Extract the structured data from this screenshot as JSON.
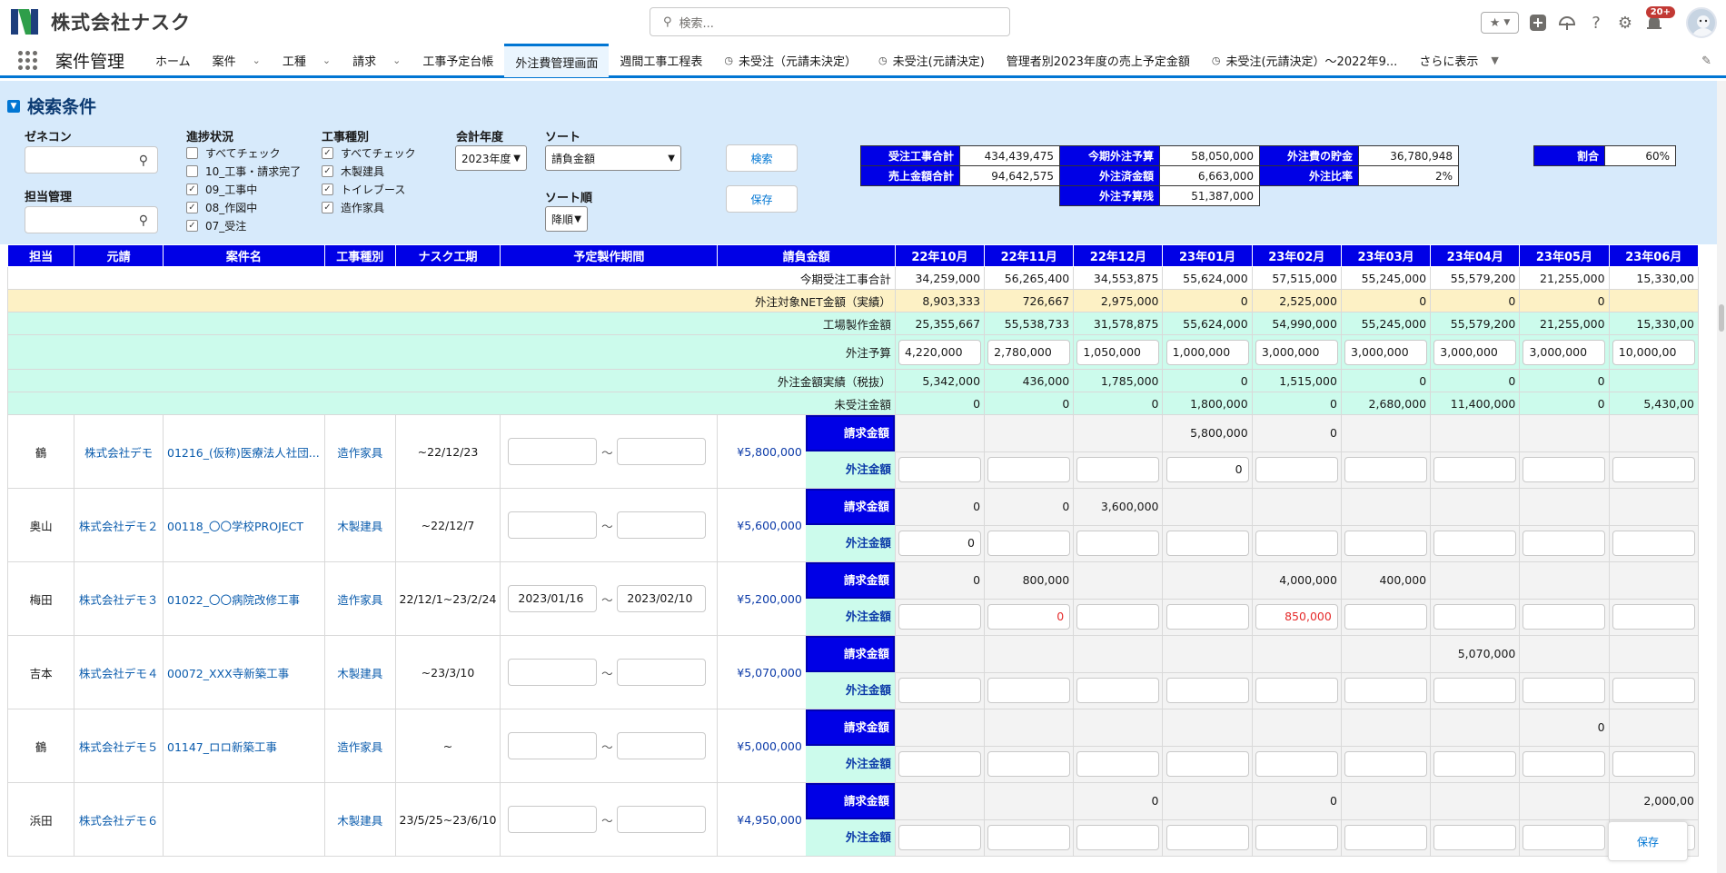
{
  "header": {
    "company": "株式会社ナスク",
    "search_placeholder": "検索...",
    "notifications": "20+"
  },
  "nav": {
    "app_name": "案件管理",
    "tabs": [
      {
        "label": "ホーム",
        "dropdown": false,
        "icon": false,
        "active": false
      },
      {
        "label": "案件",
        "dropdown": true,
        "icon": false,
        "active": false
      },
      {
        "label": "工種",
        "dropdown": true,
        "icon": false,
        "active": false
      },
      {
        "label": "請求",
        "dropdown": true,
        "icon": false,
        "active": false
      },
      {
        "label": "工事予定台帳",
        "dropdown": false,
        "icon": false,
        "active": false
      },
      {
        "label": "外注費管理画面",
        "dropdown": false,
        "icon": false,
        "active": true
      },
      {
        "label": "週間工事工程表",
        "dropdown": false,
        "icon": false,
        "active": false
      },
      {
        "label": "未受注（元請未決定）",
        "dropdown": false,
        "icon": true,
        "active": false
      },
      {
        "label": "未受注(元請決定)",
        "dropdown": false,
        "icon": true,
        "active": false
      },
      {
        "label": "管理者別2023年度の売上予定金額",
        "dropdown": false,
        "icon": false,
        "active": false
      },
      {
        "label": "未受注(元請決定）～2022年9...",
        "dropdown": false,
        "icon": true,
        "active": false
      }
    ],
    "more": "さらに表示"
  },
  "search_panel": {
    "title": "検索条件",
    "general_contractor_label": "ゼネコン",
    "manager_label": "担当管理",
    "progress_label": "進捗状況",
    "progress_options": [
      {
        "label": "すべてチェック",
        "checked": false
      },
      {
        "label": "10_工事・請求完了",
        "checked": false
      },
      {
        "label": "09_工事中",
        "checked": true
      },
      {
        "label": "08_作図中",
        "checked": true
      },
      {
        "label": "07_受注",
        "checked": true
      }
    ],
    "work_type_label": "工事種別",
    "work_type_options": [
      {
        "label": "すべてチェック",
        "checked": true
      },
      {
        "label": "木製建具",
        "checked": true
      },
      {
        "label": "トイレブース",
        "checked": true
      },
      {
        "label": "造作家具",
        "checked": true
      }
    ],
    "fiscal_year_label": "会計年度",
    "fiscal_year_value": "2023年度",
    "sort_label": "ソート",
    "sort_value": "請負金額",
    "sort_order_label": "ソート順",
    "sort_order_value": "降順",
    "search_button": "検索",
    "save_button": "保存"
  },
  "summary": {
    "received_total_label": "受注工事合計",
    "received_total": "434,439,475",
    "sales_total_label": "売上金額合計",
    "sales_total": "94,642,575",
    "budget_label": "今期外注予算",
    "budget": "58,050,000",
    "ordered_label": "外注済金額",
    "ordered": "6,663,000",
    "remaining_label": "外注予算残",
    "remaining": "51,387,000",
    "savings_label": "外注費の貯金",
    "savings": "36,780,948",
    "ratio_label": "外注比率",
    "ratio": "2%",
    "share_label": "割合",
    "share": "60%"
  },
  "table": {
    "headers": [
      "担当",
      "元請",
      "案件名",
      "工事種別",
      "ナスク工期",
      "予定製作期間",
      "請負金額"
    ],
    "months": [
      "22年10月",
      "22年11月",
      "22年12月",
      "23年01月",
      "23年02月",
      "23年03月",
      "23年04月",
      "23年05月",
      "23年06月"
    ],
    "summary_rows": [
      {
        "label": "今期受注工事合計",
        "style": "plain",
        "input": false,
        "values": [
          "34,259,000",
          "56,265,400",
          "34,553,875",
          "55,624,000",
          "57,515,000",
          "55,245,000",
          "55,579,200",
          "21,255,000",
          "15,330,00"
        ]
      },
      {
        "label": "外注対象NET金額（実績）",
        "style": "yellow",
        "input": false,
        "values": [
          "8,903,333",
          "726,667",
          "2,975,000",
          "0",
          "2,525,000",
          "0",
          "0",
          "0",
          ""
        ]
      },
      {
        "label": "工場製作金額",
        "style": "mint",
        "input": false,
        "values": [
          "25,355,667",
          "55,538,733",
          "31,578,875",
          "55,624,000",
          "54,990,000",
          "55,245,000",
          "55,579,200",
          "21,255,000",
          "15,330,00"
        ]
      },
      {
        "label": "外注予算",
        "style": "mint",
        "input": true,
        "values": [
          "4,220,000",
          "2,780,000",
          "1,050,000",
          "1,000,000",
          "3,000,000",
          "3,000,000",
          "3,000,000",
          "3,000,000",
          "10,000,00"
        ]
      },
      {
        "label": "外注金額実績（税抜）",
        "style": "mint",
        "input": false,
        "values": [
          "5,342,000",
          "436,000",
          "1,785,000",
          "0",
          "1,515,000",
          "0",
          "0",
          "0",
          ""
        ]
      },
      {
        "label": "未受注金額",
        "style": "mint",
        "input": false,
        "values": [
          "0",
          "0",
          "0",
          "1,800,000",
          "0",
          "2,680,000",
          "11,400,000",
          "0",
          "5,430,00"
        ]
      }
    ],
    "billing_label": "請求金額",
    "outsource_label": "外注金額",
    "projects": [
      {
        "tanto": "鶴",
        "client": "株式会社デモ",
        "name": "01216_(仮称)医療法人社団...",
        "type": "造作家具",
        "period": "~22/12/23",
        "start": "",
        "end": "",
        "amount": "¥5,800,000",
        "billing": [
          "",
          "",
          "",
          "5,800,000",
          "0",
          "",
          "",
          "",
          ""
        ],
        "outsource": [
          "",
          "",
          "",
          "0",
          "",
          "",
          "",
          "",
          ""
        ]
      },
      {
        "tanto": "奥山",
        "client": "株式会社デモ２",
        "name": "00118_〇〇学校PROJECT",
        "type": "木製建具",
        "period": "~22/12/7",
        "start": "",
        "end": "",
        "amount": "¥5,600,000",
        "billing": [
          "0",
          "0",
          "3,600,000",
          "",
          "",
          "",
          "",
          "",
          ""
        ],
        "outsource": [
          "0",
          "",
          "",
          "",
          "",
          "",
          "",
          "",
          ""
        ]
      },
      {
        "tanto": "梅田",
        "client": "株式会社デモ３",
        "name": "01022_〇〇病院改修工事",
        "type": "造作家具",
        "period": "22/12/1~23/2/24",
        "start": "2023/01/16",
        "end": "2023/02/10",
        "amount": "¥5,200,000",
        "billing": [
          "0",
          "800,000",
          "",
          "",
          "4,000,000",
          "400,000",
          "",
          "",
          ""
        ],
        "outsource": [
          "",
          "0",
          "",
          "",
          "850,000",
          "",
          "",
          "",
          ""
        ]
      },
      {
        "tanto": "吉本",
        "client": "株式会社デモ４",
        "name": "00072_XXX寺新築工事",
        "type": "木製建具",
        "period": "~23/3/10",
        "start": "",
        "end": "",
        "amount": "¥5,070,000",
        "billing": [
          "",
          "",
          "",
          "",
          "",
          "",
          "5,070,000",
          "",
          ""
        ],
        "outsource": [
          "",
          "",
          "",
          "",
          "",
          "",
          "",
          "",
          ""
        ]
      },
      {
        "tanto": "鶴",
        "client": "株式会社デモ５",
        "name": "01147_ロロ新築工事",
        "type": "造作家具",
        "period": "~",
        "start": "",
        "end": "",
        "amount": "¥5,000,000",
        "billing": [
          "",
          "",
          "",
          "",
          "",
          "",
          "",
          "0",
          ""
        ],
        "outsource": [
          "",
          "",
          "",
          "",
          "",
          "",
          "",
          "",
          ""
        ]
      },
      {
        "tanto": "浜田",
        "client": "株式会社デモ６",
        "name": "",
        "type": "木製建具",
        "period": "23/5/25~23/6/10",
        "start": "",
        "end": "",
        "amount": "¥4,950,000",
        "billing": [
          "",
          "",
          "0",
          "",
          "0",
          "",
          "",
          "",
          "2,000,00"
        ],
        "outsource": [
          "",
          "",
          "",
          "",
          "",
          "",
          "",
          "",
          ""
        ]
      }
    ],
    "red_cells": [
      [
        2,
        1
      ],
      [
        2,
        4
      ]
    ]
  },
  "floating_save": "保存"
}
